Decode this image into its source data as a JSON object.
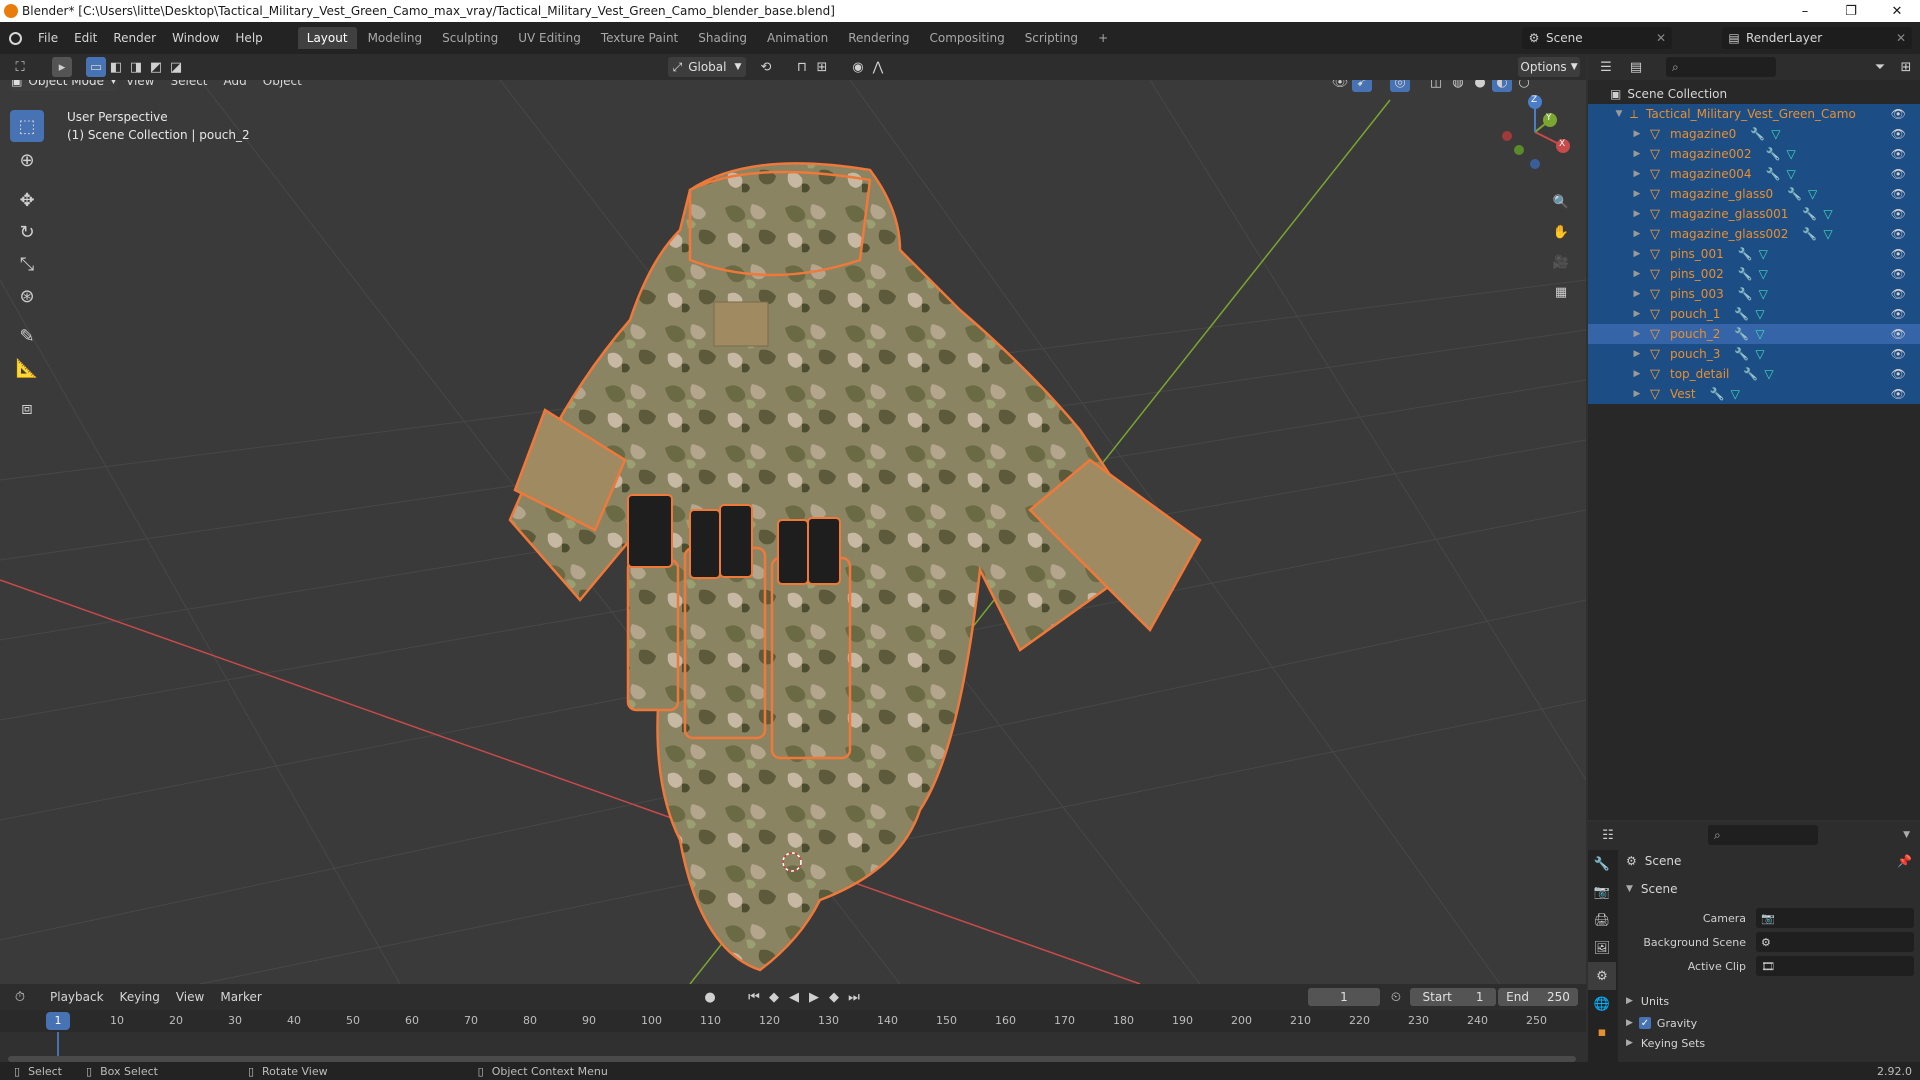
{
  "window": {
    "title": "Blender* [C:\\Users\\litte\\Desktop\\Tactical_Military_Vest_Green_Camo_max_vray/Tactical_Military_Vest_Green_Camo_blender_base.blend]",
    "minimize": "–",
    "maximize": "❐",
    "close": "✕"
  },
  "menu": [
    "File",
    "Edit",
    "Render",
    "Window",
    "Help"
  ],
  "workspaces": [
    "Layout",
    "Modeling",
    "Sculpting",
    "UV Editing",
    "Texture Paint",
    "Shading",
    "Animation",
    "Rendering",
    "Compositing",
    "Scripting"
  ],
  "active_workspace": "Layout",
  "add_workspace": "+",
  "scene_name": "Scene",
  "view_layer": "RenderLayer",
  "viewport_header": {
    "mode": "Object Mode",
    "menus": [
      "View",
      "Select",
      "Add",
      "Object"
    ],
    "transform_orientation": "Global",
    "options": "Options"
  },
  "viewport": {
    "perspective": "User Perspective",
    "collection_info": "(1) Scene Collection | pouch_2",
    "gizmo": {
      "x": "X",
      "y": "Y",
      "z": "Z"
    }
  },
  "colors": {
    "accent": "#4772b3",
    "selection_outline": "#f0793a",
    "x_axis": "#c94a4a",
    "y_axis": "#7aa631",
    "outliner_selected": "#1c4d85",
    "outliner_active": "#3565a8"
  },
  "outliner": {
    "root": "Scene Collection",
    "collection": "Tactical_Military_Vest_Green_Camo",
    "objects": [
      "magazine0",
      "magazine002",
      "magazine004",
      "magazine_glass0",
      "magazine_glass001",
      "magazine_glass002",
      "pins_001",
      "pins_002",
      "pins_003",
      "pouch_1",
      "pouch_2",
      "pouch_3",
      "top_detail",
      "Vest"
    ],
    "active_object": "pouch_2"
  },
  "properties": {
    "context": "Scene",
    "panel": "Scene",
    "fields": [
      {
        "label": "Camera",
        "value": ""
      },
      {
        "label": "Background Scene",
        "value": ""
      },
      {
        "label": "Active Clip",
        "value": ""
      }
    ],
    "subpanels": [
      "Units",
      "Gravity",
      "Keying Sets"
    ],
    "gravity_checked": true
  },
  "timeline": {
    "menus": [
      "Playback",
      "Keying",
      "View",
      "Marker"
    ],
    "current_frame": "1",
    "start_label": "Start",
    "start": "1",
    "end_label": "End",
    "end": "250",
    "ruler": [
      "10",
      "20",
      "30",
      "40",
      "50",
      "60",
      "70",
      "80",
      "90",
      "100",
      "110",
      "120",
      "130",
      "140",
      "150",
      "160",
      "170",
      "180",
      "190",
      "200",
      "210",
      "220",
      "230",
      "240",
      "250"
    ],
    "playhead": "1"
  },
  "statusbar": {
    "select": "Select",
    "box_select": "Box Select",
    "rotate": "Rotate View",
    "context_menu": "Object Context Menu",
    "version": "2.92.0"
  }
}
